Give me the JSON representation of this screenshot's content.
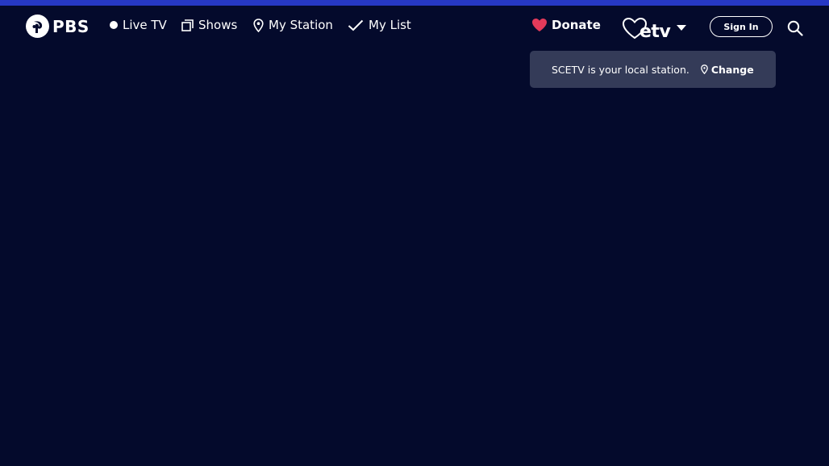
{
  "site": {
    "logo_text": "PBS",
    "accent_strip_color": "#2638c4",
    "background_color": "#040a2c"
  },
  "nav": {
    "items": [
      {
        "label": "Live TV",
        "icon": "live-dot-icon"
      },
      {
        "label": "Shows",
        "icon": "shows-stack-icon"
      },
      {
        "label": "My Station",
        "icon": "location-pin-icon"
      },
      {
        "label": "My List",
        "icon": "checkmark-icon"
      }
    ]
  },
  "actions": {
    "donate_label": "Donate",
    "donate_icon_color": "#e33a5a",
    "station_logo_text": "etv",
    "signin_label": "Sign In"
  },
  "station_popup": {
    "message": "SCETV is your local station.",
    "change_label": "Change",
    "background_color": "#343b58"
  }
}
